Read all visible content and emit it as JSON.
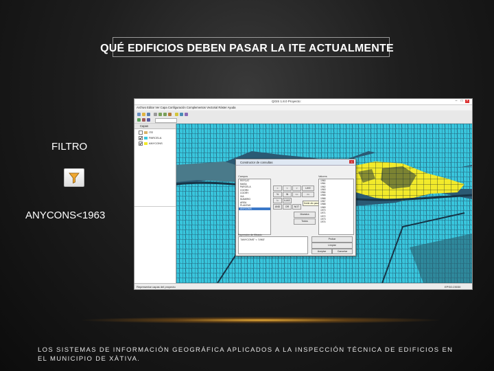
{
  "slide": {
    "title": "QUÉ EDIFICIOS DEBEN PASAR LA ITE ACTUALMENTE",
    "filter_label": "FILTRO",
    "filter_icon": "funnel-icon",
    "expression": "ANYCONS<1963",
    "footer": "LOS SISTEMAS DE INFORMACIÓN GEOGRÁFICA APLICADOS A LA INSPECCIÓN TÉCNICA DE EDIFICIOS EN EL MUNICIPIO DE XÀTIVA."
  },
  "colors": {
    "map_parcel": "#39c6dd",
    "map_selected": "#f2ea2b",
    "map_background": "#2b5a74",
    "accent_glow": "#f3a632"
  },
  "app": {
    "window_title": "QGIS 1.8.0 Proyecto:",
    "menu": "Archivo  Editar  Ver  Capa  Configuración  Complementos  Vectorial  Ráster  Ayuda",
    "layers_panel_title": "Capas",
    "layers": [
      {
        "name": "ITE",
        "checked": false
      },
      {
        "name": "PARCELA",
        "checked": true
      },
      {
        "name": "ANYCONS",
        "checked": true
      }
    ],
    "status_left": "Representar capas del proyecto",
    "status_right": "EPSG:23030"
  },
  "query_dialog": {
    "title": "Constructor de consultas",
    "fields_label": "Campos",
    "values_label": "Valores",
    "fields": [
      "REFCAT",
      "MASA",
      "PARCELA",
      "COORX",
      "COORY",
      "VIA",
      "NUMERO",
      "AREA",
      "PLANTAS",
      "ANYCONS"
    ],
    "selected_field": "ANYCONS",
    "values": [
      "1960",
      "1961",
      "1962",
      "1963",
      "1964",
      "1965",
      "1966",
      "1967",
      "1968",
      "1969",
      "1970",
      "1971",
      "1972",
      "1973",
      "1974"
    ],
    "operators": [
      "=",
      "<",
      ">",
      "LIKE",
      "%",
      "IN",
      "<=",
      ">=",
      "!=",
      "ILIKE",
      "AND",
      "OR",
      "NOT"
    ],
    "sample_button": "Muestra",
    "all_button": "Todos",
    "expression_label": "Expresión de filtrado",
    "expression": "\"ANYCONS\" < '1963'",
    "test_button": "Probar",
    "clear_button": "Limpiar",
    "ok_button": "Aceptar",
    "cancel_button": "Cancelar",
    "tooltip": "Doble clic para agregar el valor"
  }
}
